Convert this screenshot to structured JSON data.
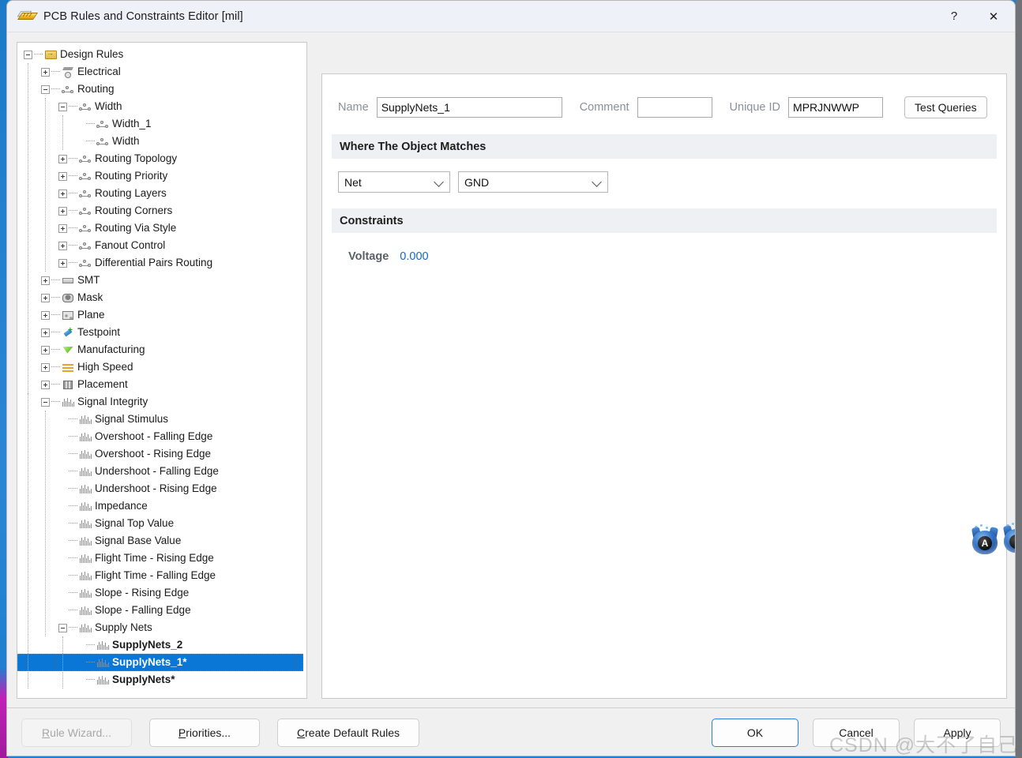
{
  "window": {
    "title": "PCB Rules and Constraints Editor [mil]",
    "icon": "pcb-ruler-icon",
    "help_label": "?",
    "close_label": "✕"
  },
  "tree": {
    "nodes": [
      {
        "label": "Design Rules",
        "depth": 0,
        "toggle": "minus",
        "icon": "folder-icon"
      },
      {
        "label": "Electrical",
        "depth": 1,
        "toggle": "plus",
        "icon": "electrical-icon"
      },
      {
        "label": "Routing",
        "depth": 1,
        "toggle": "minus",
        "icon": "net-icon"
      },
      {
        "label": "Width",
        "depth": 2,
        "toggle": "minus",
        "icon": "net-icon"
      },
      {
        "label": "Width_1",
        "depth": 3,
        "toggle": "leaf",
        "icon": "net-icon"
      },
      {
        "label": "Width",
        "depth": 3,
        "toggle": "leaf",
        "icon": "net-icon"
      },
      {
        "label": "Routing Topology",
        "depth": 2,
        "toggle": "plus",
        "icon": "net-icon"
      },
      {
        "label": "Routing Priority",
        "depth": 2,
        "toggle": "plus",
        "icon": "net-icon"
      },
      {
        "label": "Routing Layers",
        "depth": 2,
        "toggle": "plus",
        "icon": "net-icon"
      },
      {
        "label": "Routing Corners",
        "depth": 2,
        "toggle": "plus",
        "icon": "net-icon"
      },
      {
        "label": "Routing Via Style",
        "depth": 2,
        "toggle": "plus",
        "icon": "net-icon"
      },
      {
        "label": "Fanout Control",
        "depth": 2,
        "toggle": "plus",
        "icon": "net-icon"
      },
      {
        "label": "Differential Pairs Routing",
        "depth": 2,
        "toggle": "plus",
        "icon": "net-icon"
      },
      {
        "label": "SMT",
        "depth": 1,
        "toggle": "plus",
        "icon": "smt-icon"
      },
      {
        "label": "Mask",
        "depth": 1,
        "toggle": "plus",
        "icon": "mask-icon"
      },
      {
        "label": "Plane",
        "depth": 1,
        "toggle": "plus",
        "icon": "plane-icon"
      },
      {
        "label": "Testpoint",
        "depth": 1,
        "toggle": "plus",
        "icon": "testpoint-icon"
      },
      {
        "label": "Manufacturing",
        "depth": 1,
        "toggle": "plus",
        "icon": "manufacturing-icon"
      },
      {
        "label": "High Speed",
        "depth": 1,
        "toggle": "plus",
        "icon": "highspeed-icon"
      },
      {
        "label": "Placement",
        "depth": 1,
        "toggle": "plus",
        "icon": "placement-icon"
      },
      {
        "label": "Signal Integrity",
        "depth": 1,
        "toggle": "minus",
        "icon": "signal-icon"
      },
      {
        "label": "Signal Stimulus",
        "depth": 2,
        "toggle": "leaf",
        "icon": "signal-icon"
      },
      {
        "label": "Overshoot - Falling Edge",
        "depth": 2,
        "toggle": "leaf",
        "icon": "signal-icon"
      },
      {
        "label": "Overshoot - Rising Edge",
        "depth": 2,
        "toggle": "leaf",
        "icon": "signal-icon"
      },
      {
        "label": "Undershoot - Falling Edge",
        "depth": 2,
        "toggle": "leaf",
        "icon": "signal-icon"
      },
      {
        "label": "Undershoot - Rising Edge",
        "depth": 2,
        "toggle": "leaf",
        "icon": "signal-icon"
      },
      {
        "label": "Impedance",
        "depth": 2,
        "toggle": "leaf",
        "icon": "signal-icon"
      },
      {
        "label": "Signal Top Value",
        "depth": 2,
        "toggle": "leaf",
        "icon": "signal-icon"
      },
      {
        "label": "Signal Base Value",
        "depth": 2,
        "toggle": "leaf",
        "icon": "signal-icon"
      },
      {
        "label": "Flight Time - Rising Edge",
        "depth": 2,
        "toggle": "leaf",
        "icon": "signal-icon"
      },
      {
        "label": "Flight Time - Falling Edge",
        "depth": 2,
        "toggle": "leaf",
        "icon": "signal-icon"
      },
      {
        "label": "Slope - Rising Edge",
        "depth": 2,
        "toggle": "leaf",
        "icon": "signal-icon"
      },
      {
        "label": "Slope - Falling Edge",
        "depth": 2,
        "toggle": "leaf",
        "icon": "signal-icon"
      },
      {
        "label": "Supply Nets",
        "depth": 2,
        "toggle": "minus",
        "icon": "signal-icon"
      },
      {
        "label": "SupplyNets_2",
        "depth": 3,
        "toggle": "leaf",
        "icon": "signal-icon",
        "bold": true
      },
      {
        "label": "SupplyNets_1*",
        "depth": 3,
        "toggle": "leaf",
        "icon": "signal-icon",
        "bold": true,
        "selected": true
      },
      {
        "label": "SupplyNets*",
        "depth": 3,
        "toggle": "leaf",
        "icon": "signal-icon",
        "bold": true
      }
    ]
  },
  "form": {
    "name_label": "Name",
    "name_value": "SupplyNets_1",
    "comment_label": "Comment",
    "comment_value": "",
    "comment_placeholder": "",
    "unique_id_label": "Unique ID",
    "unique_id_value": "MPRJNWWP",
    "test_queries_label": "Test Queries"
  },
  "match_section": {
    "title": "Where The Object Matches",
    "kind_value": "Net",
    "scope_value": "GND"
  },
  "constraints_section": {
    "title": "Constraints",
    "voltage_label": "Voltage",
    "voltage_value": "0.000"
  },
  "footer": {
    "rule_wizard_label": "Rule Wizard...",
    "priorities_label": "Priorities...",
    "create_default_label": "Create Default Rules",
    "ok_label": "OK",
    "cancel_label": "Cancel",
    "apply_label": "Apply"
  },
  "overlay": {
    "watermark": "CSDN @大不了自己学咯",
    "ime_a": "A",
    "ime_b": ","
  },
  "colors": {
    "selection_blue": "#0a76d6",
    "link_blue": "#1268c3",
    "label_gray": "#8a9099",
    "section_bg": "#eef0f3",
    "primary_border": "#2a7fd4"
  }
}
